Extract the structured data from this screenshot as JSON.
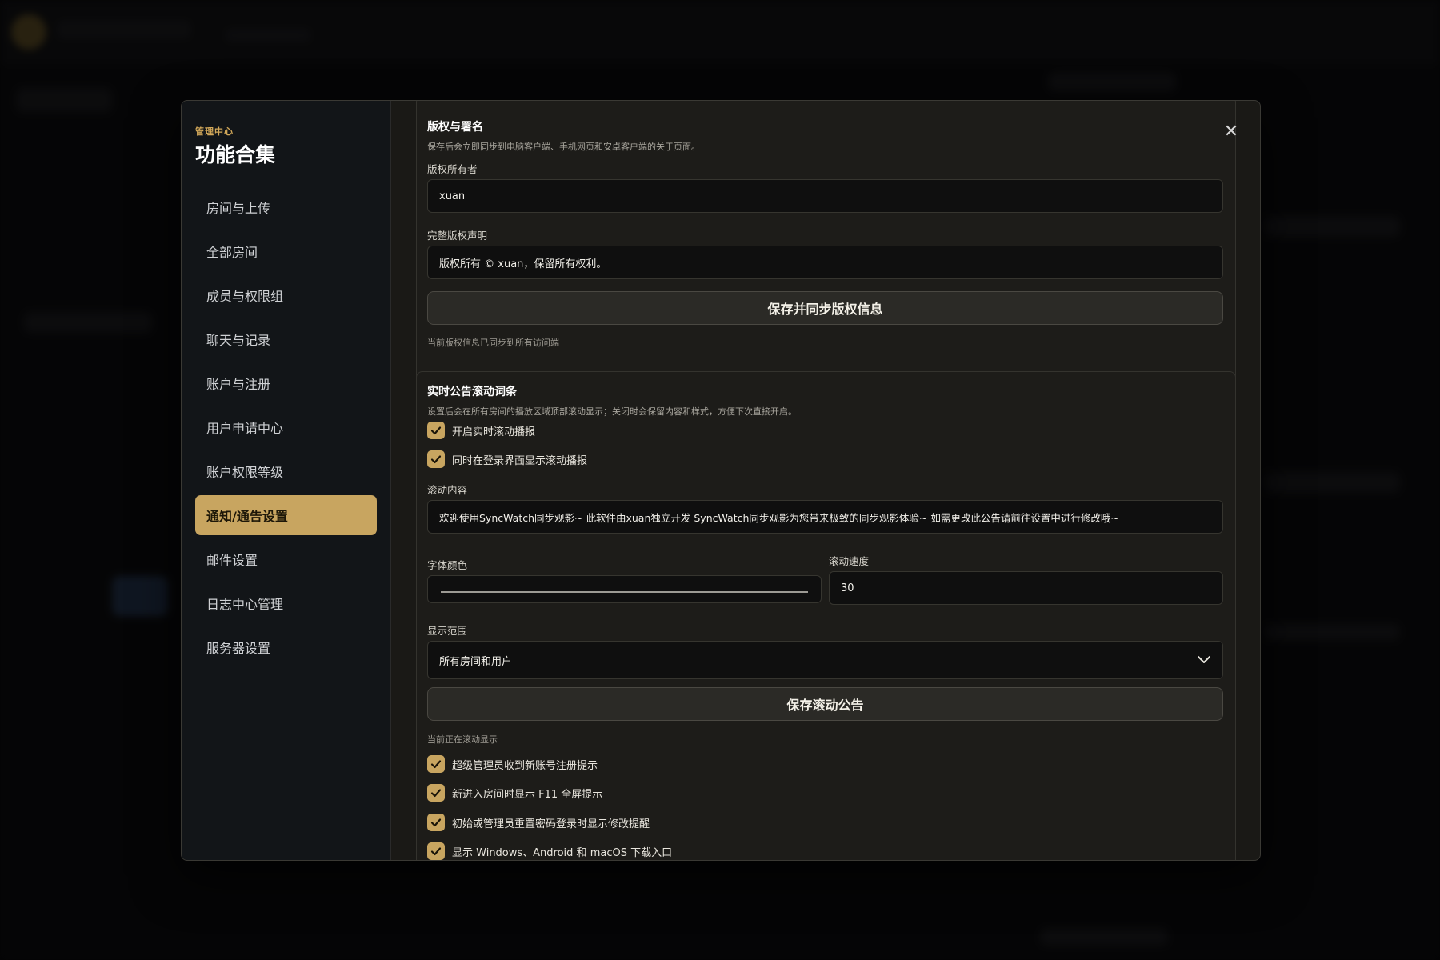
{
  "sidebar": {
    "kicker": "管理中心",
    "title": "功能合集",
    "items": [
      {
        "label": "房间与上传"
      },
      {
        "label": "全部房间"
      },
      {
        "label": "成员与权限组"
      },
      {
        "label": "聊天与记录"
      },
      {
        "label": "账户与注册"
      },
      {
        "label": "用户申请中心"
      },
      {
        "label": "账户权限等级"
      },
      {
        "label": "通知/通告设置"
      },
      {
        "label": "邮件设置"
      },
      {
        "label": "日志中心管理"
      },
      {
        "label": "服务器设置"
      }
    ],
    "active_label": "通知/通告设置"
  },
  "close": {
    "icon": "close-icon",
    "glyph": "✕"
  },
  "copyright": {
    "title": "版权与署名",
    "description": "保存后会立即同步到电脑客户端、手机网页和安卓客户端的关于页面。",
    "owner_label": "版权所有者",
    "owner_value": "xuan",
    "statement_label": "完整版权声明",
    "statement_value": "版权所有 © xuan，保留所有权利。",
    "save_button": "保存并同步版权信息",
    "status": "当前版权信息已同步到所有访问端"
  },
  "ticker": {
    "title": "实时公告滚动词条",
    "description": "设置后会在所有房间的播放区域顶部滚动显示；关闭时会保留内容和样式，方便下次直接开启。",
    "enable_label": "开启实时滚动播报",
    "enable_checked": true,
    "login_label": "同时在登录界面显示滚动播报",
    "login_checked": true,
    "content_label": "滚动内容",
    "content_value": "欢迎使用SyncWatch同步观影~ 此软件由xuan独立开发 SyncWatch同步观影为您带来极致的同步观影体验~ 如需更改此公告请前往设置中进行修改哦~",
    "font_color_label": "字体颜色",
    "speed_label": "滚动速度",
    "speed_value": "30",
    "scope_label": "显示范围",
    "scope_value": "所有房间和用户",
    "save_button": "保存滚动公告",
    "status": "当前正在滚动显示"
  },
  "options": [
    {
      "label": "超级管理员收到新账号注册提示",
      "checked": true
    },
    {
      "label": "新进入房间时显示 F11 全屏提示",
      "checked": true
    },
    {
      "label": "初始或管理员重置密码登录时显示修改提醒",
      "checked": true
    },
    {
      "label": "显示 Windows、Android 和 macOS 下载入口",
      "checked": true
    }
  ],
  "colors": {
    "accent": "#c8a560",
    "panel": "#1d1c19",
    "sidebar": "#121518"
  }
}
